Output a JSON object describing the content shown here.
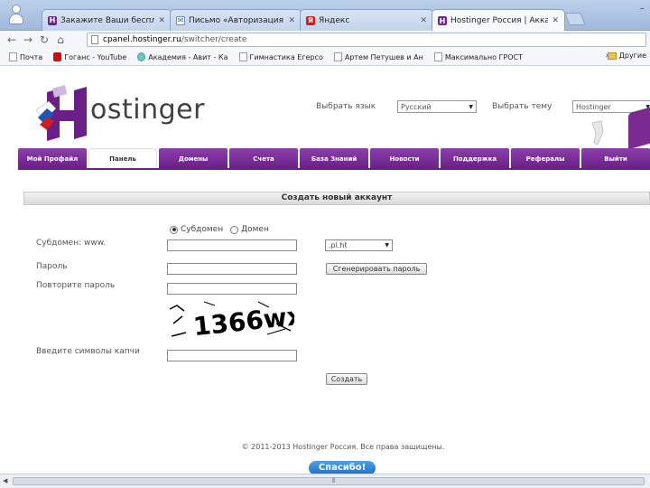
{
  "browser": {
    "tabs": [
      {
        "title": "Закажите Ваши бесплатны",
        "icon": "hostinger-favicon"
      },
      {
        "title": "Письмо «Авторизация С",
        "icon": "mail-favicon"
      },
      {
        "title": "Яндекс",
        "icon": "yandex-favicon"
      },
      {
        "title": "Hostinger Россия | Аккаунт",
        "icon": "hostinger-favicon",
        "active": true
      }
    ],
    "tab_close": "✕",
    "url_host": "cpanel.hostinger.ru",
    "url_path": "/switcher/create",
    "bookmarks": [
      {
        "label": "Почта",
        "icon": "page-icon"
      },
      {
        "label": "Гоганс - YouTube",
        "icon": "youtube-icon"
      },
      {
        "label": "Академия - Авит - Ка",
        "icon": "academy-icon"
      },
      {
        "label": "Гимнастика Егерсо",
        "icon": "page-icon"
      },
      {
        "label": "Артем Петушев и Ан",
        "icon": "page-icon"
      },
      {
        "label": "Максимально ГРОСТ",
        "icon": "page-icon"
      }
    ],
    "bookmarks_more": "»",
    "bookmarks_other": "Другие"
  },
  "header": {
    "logo_text": "ostinger",
    "lang_label": "Выбрать язык",
    "lang_value": "Русский",
    "theme_label": "Выбрать тему",
    "theme_value": "Hostinger"
  },
  "nav": [
    {
      "label": "Мой Профайл"
    },
    {
      "label": "Панель",
      "active": true
    },
    {
      "label": "Домены"
    },
    {
      "label": "Счета"
    },
    {
      "label": "База Знаний"
    },
    {
      "label": "Новости"
    },
    {
      "label": "Поддержка"
    },
    {
      "label": "Рефералы"
    },
    {
      "label": "Выйти"
    }
  ],
  "form": {
    "title": "Создать новый аккаунт",
    "radio_subdomain": "Субдомен",
    "radio_domain": "Домен",
    "subdomain_label": "Субдомен: www.",
    "subdomain_suffix": ".pl.ht",
    "password_label": "Пароль",
    "generate_button": "Сгенерировать пароль",
    "repeat_label": "Повторите пароль",
    "captcha_text": "1366wx",
    "captcha_label": "Введите символы капчи",
    "create_button": "Создать"
  },
  "footer": {
    "copyright": "© 2011-2013 Hostinger Россия. Все права защищены.",
    "thanks_badge": "Спасибо!"
  },
  "colors": {
    "brand_purple": "#6a1f88",
    "tab_bg": "#bcd0ea"
  }
}
